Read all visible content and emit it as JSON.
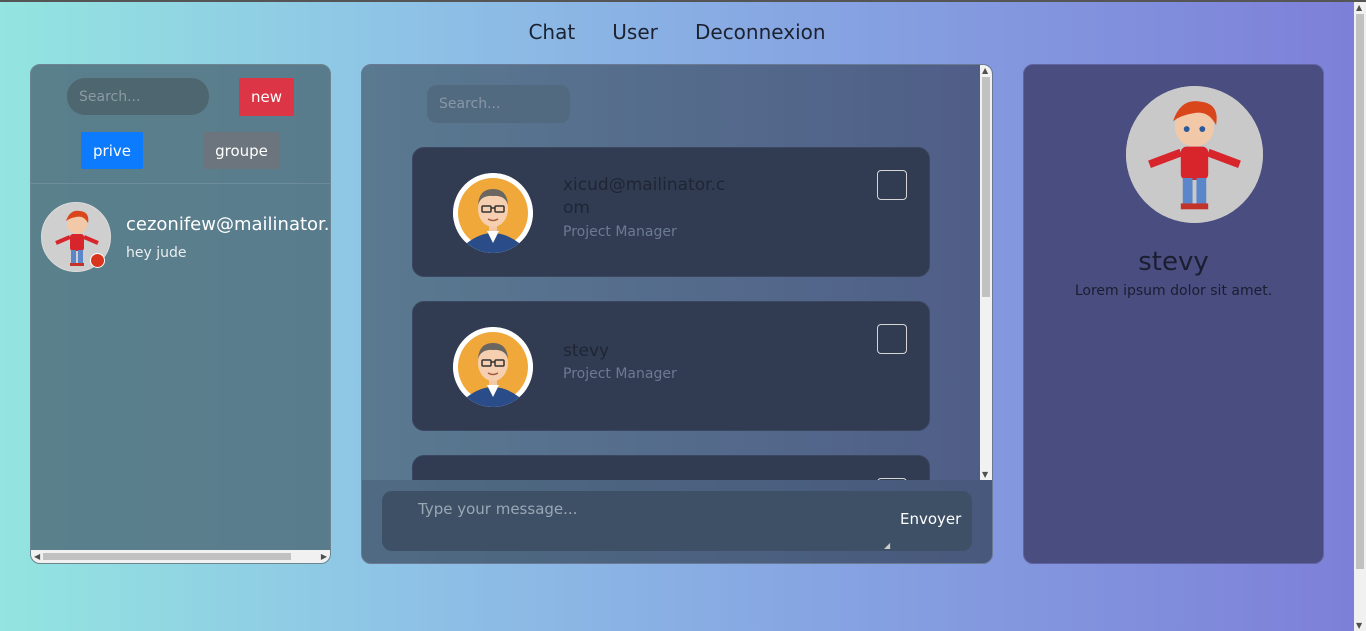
{
  "nav": {
    "chat": "Chat",
    "user": "User",
    "logout": "Deconnexion"
  },
  "left": {
    "search_placeholder": "Search...",
    "new_label": "new",
    "prive_label": "prive",
    "groupe_label": "groupe",
    "contacts": [
      {
        "name": "cezonifew@mailinator.com",
        "last_message": "hey jude",
        "status_color": "#d9341c"
      }
    ]
  },
  "center": {
    "search_placeholder": "Search...",
    "users": [
      {
        "name": "xicud@mailinator.com",
        "role": "Project Manager"
      },
      {
        "name": "stevy",
        "role": "Project Manager"
      }
    ],
    "message_placeholder": "Type your message...",
    "send_label": "Envoyer"
  },
  "right": {
    "name": "stevy",
    "bio": "Lorem ipsum dolor sit amet."
  },
  "colors": {
    "new": "#dc3545",
    "prive": "#0d7bfd",
    "groupe": "#6c757d"
  },
  "icons": {
    "avatar_kid": "kid-avatar-icon",
    "avatar_manager": "manager-avatar-icon"
  }
}
